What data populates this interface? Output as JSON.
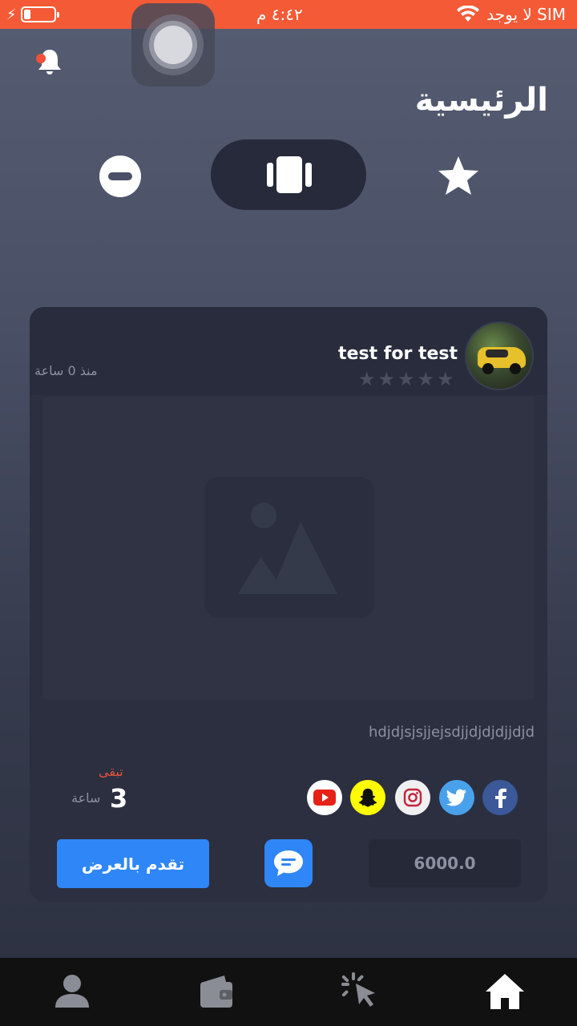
{
  "status_bar": {
    "carrier": "لا يوجد SIM",
    "time": "٤:٤٢ م"
  },
  "header": {
    "title": "الرئيسية"
  },
  "view_toggle": {
    "options": [
      "minus-circle-icon",
      "cards-icon",
      "star-icon"
    ],
    "selected": "cards-icon"
  },
  "listing": {
    "user_name": "test for test",
    "rating_stars": 5,
    "rating_filled": 0,
    "time_ago": "منذ 0 ساعة",
    "description": "hdjdjsjsjjejsdjjdjdjdjjdjd",
    "remaining_label": "تبقى",
    "remaining_value": "3",
    "remaining_unit": "ساعة",
    "social_links": [
      "facebook-icon",
      "twitter-icon",
      "instagram-icon",
      "snapchat-icon",
      "youtube-icon"
    ],
    "price": "6000.0",
    "bid_button_label": "تقدم بالعرض"
  },
  "bottom_nav": {
    "items": [
      "profile-icon",
      "wallet-icon",
      "auctions-icon",
      "home-icon"
    ],
    "active": "home-icon"
  },
  "colors": {
    "status_bar": "#f45a36",
    "accent": "#2f86f6",
    "remaining_label": "#e5533c"
  }
}
